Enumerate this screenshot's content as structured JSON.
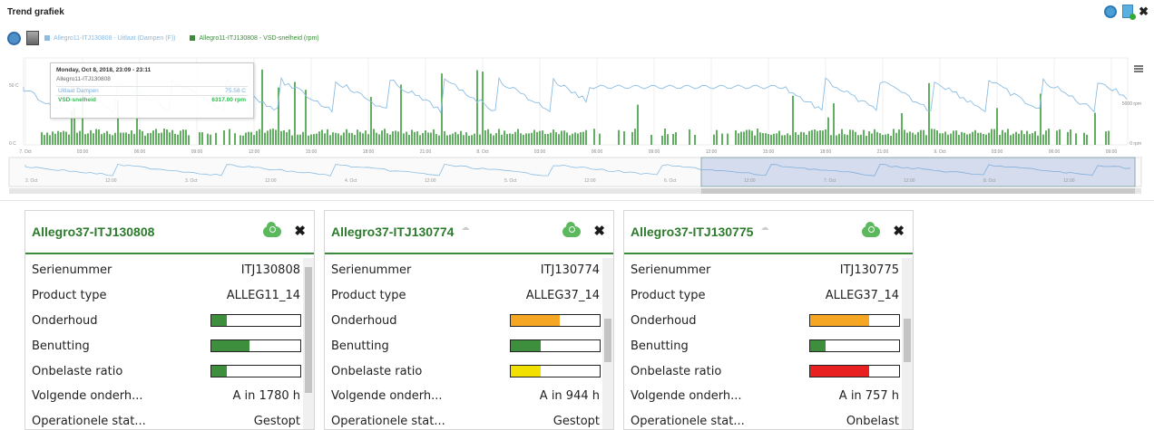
{
  "panel": {
    "title": "Trend grafiek"
  },
  "legend": {
    "series1": "Allegro11-ITJ130808 - Uitlaat (Dampen (F))",
    "series2": "Allegro11-ITJ130808 - VSD-snelheid (rpm)"
  },
  "tooltip": {
    "header": "Monday, Oct 8, 2018, 23:09 - 23:11",
    "subtitle": "Allegro11-ITJ130808",
    "row1_label": "Uitlaat Dampen",
    "row1_value": "75.58 C",
    "row2_label": "VSD-snelheid",
    "row2_value": "6317.00 rpm"
  },
  "chart_data": {
    "type": "line",
    "x_tick_labels": [
      "7. Oct",
      "03:00",
      "06:00",
      "09:00",
      "12:00",
      "15:00",
      "18:00",
      "21:00",
      "8. Oct",
      "03:00",
      "06:00",
      "09:00",
      "12:00",
      "15:00",
      "18:00",
      "21:00",
      "9. Oct",
      "03:00",
      "06:00",
      "09:00"
    ],
    "navigator_labels": [
      "2. Oct",
      "12:00",
      "3. Oct",
      "12:00",
      "4. Oct",
      "12:00",
      "5. Oct",
      "12:00",
      "6. Oct",
      "12:00",
      "7. Oct",
      "12:00",
      "8. Oct",
      "12:00",
      "9. Oct"
    ],
    "left_axis_labels": [
      "50 C",
      "0 C"
    ],
    "right_axis_labels": [
      "5000 rpm",
      "0 rpm"
    ],
    "series": [
      {
        "name": "Allegro11-ITJ130808 - Uitlaat (Dampen (F))",
        "color": "#8bbde3"
      },
      {
        "name": "Allegro11-ITJ130808 - VSD-snelheid (rpm)",
        "color": "#3a9a3a"
      }
    ]
  },
  "cards": [
    {
      "title": "Allegro37-ITJ130808",
      "show_ghost": false,
      "rows": [
        {
          "label": "Serienummer",
          "value": "ITJ130808"
        },
        {
          "label": "Product type",
          "value": "ALLEG11_14"
        },
        {
          "label": "Onderhoud",
          "bar": 0.17,
          "color": "#3d8f3d"
        },
        {
          "label": "Benutting",
          "bar": 0.43,
          "color": "#3d8f3d"
        },
        {
          "label": "Onbelaste ratio",
          "bar": 0.17,
          "color": "#3d8f3d"
        },
        {
          "label": "Volgende onderh...",
          "value": "A in 1780 h"
        },
        {
          "label": "Operationele stat...",
          "value": "Gestopt"
        }
      ],
      "scroll_thumb": [
        0.05,
        0.78
      ]
    },
    {
      "title": "Allegro37-ITJ130774",
      "show_ghost": true,
      "rows": [
        {
          "label": "Serienummer",
          "value": "ITJ130774"
        },
        {
          "label": "Product type",
          "value": "ALLEG37_14"
        },
        {
          "label": "Onderhoud",
          "bar": 0.55,
          "color": "#f5a623"
        },
        {
          "label": "Benutting",
          "bar": 0.34,
          "color": "#3d8f3d"
        },
        {
          "label": "Onbelaste ratio",
          "bar": 0.34,
          "color": "#f2e000"
        },
        {
          "label": "Volgende onderh...",
          "value": "A in 944 h"
        },
        {
          "label": "Operationele stat...",
          "value": "Gestopt"
        }
      ],
      "scroll_thumb": [
        0.35,
        0.6
      ]
    },
    {
      "title": "Allegro37-ITJ130775",
      "show_ghost": true,
      "rows": [
        {
          "label": "Serienummer",
          "value": "ITJ130775"
        },
        {
          "label": "Product type",
          "value": "ALLEG37_14"
        },
        {
          "label": "Onderhoud",
          "bar": 0.66,
          "color": "#f5a623"
        },
        {
          "label": "Benutting",
          "bar": 0.17,
          "color": "#3d8f3d"
        },
        {
          "label": "Onbelaste ratio",
          "bar": 0.66,
          "color": "#e82020"
        },
        {
          "label": "Volgende onderh...",
          "value": "A in 757 h"
        },
        {
          "label": "Operationele stat...",
          "value": "Onbelast"
        }
      ],
      "scroll_thumb": [
        0.35,
        0.6
      ]
    }
  ]
}
